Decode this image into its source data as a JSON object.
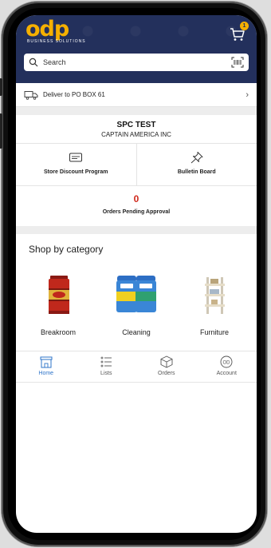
{
  "brand": {
    "logo_text": "odp",
    "logo_subtext": "BUSINESS SOLUTIONS"
  },
  "header": {
    "cart_badge": "1"
  },
  "search": {
    "placeholder": "Search"
  },
  "delivery": {
    "label": "Deliver to PO BOX 61"
  },
  "account": {
    "name": "SPC TEST",
    "company": "CAPTAIN AMERICA INC"
  },
  "tiles": [
    {
      "label": "Store Discount Program",
      "icon": "card-icon"
    },
    {
      "label": "Bulletin Board",
      "icon": "pin-icon"
    }
  ],
  "pending": {
    "count": "0",
    "label": "Orders Pending Approval"
  },
  "categories": {
    "title": "Shop by category",
    "items": [
      {
        "label": "Breakroom",
        "icon": "coffee-can-image"
      },
      {
        "label": "Cleaning",
        "icon": "wipes-image"
      },
      {
        "label": "Furniture",
        "icon": "shelf-image"
      }
    ]
  },
  "nav": {
    "items": [
      {
        "label": "Home",
        "icon": "store-icon",
        "active": true
      },
      {
        "label": "Lists",
        "icon": "list-icon"
      },
      {
        "label": "Orders",
        "icon": "box-icon"
      },
      {
        "label": "Account",
        "icon": "account-icon"
      }
    ]
  },
  "colors": {
    "header_bg": "#23305c",
    "brand_yellow": "#f5b000",
    "pending_red": "#d0281b",
    "active_blue": "#2e74c9"
  }
}
